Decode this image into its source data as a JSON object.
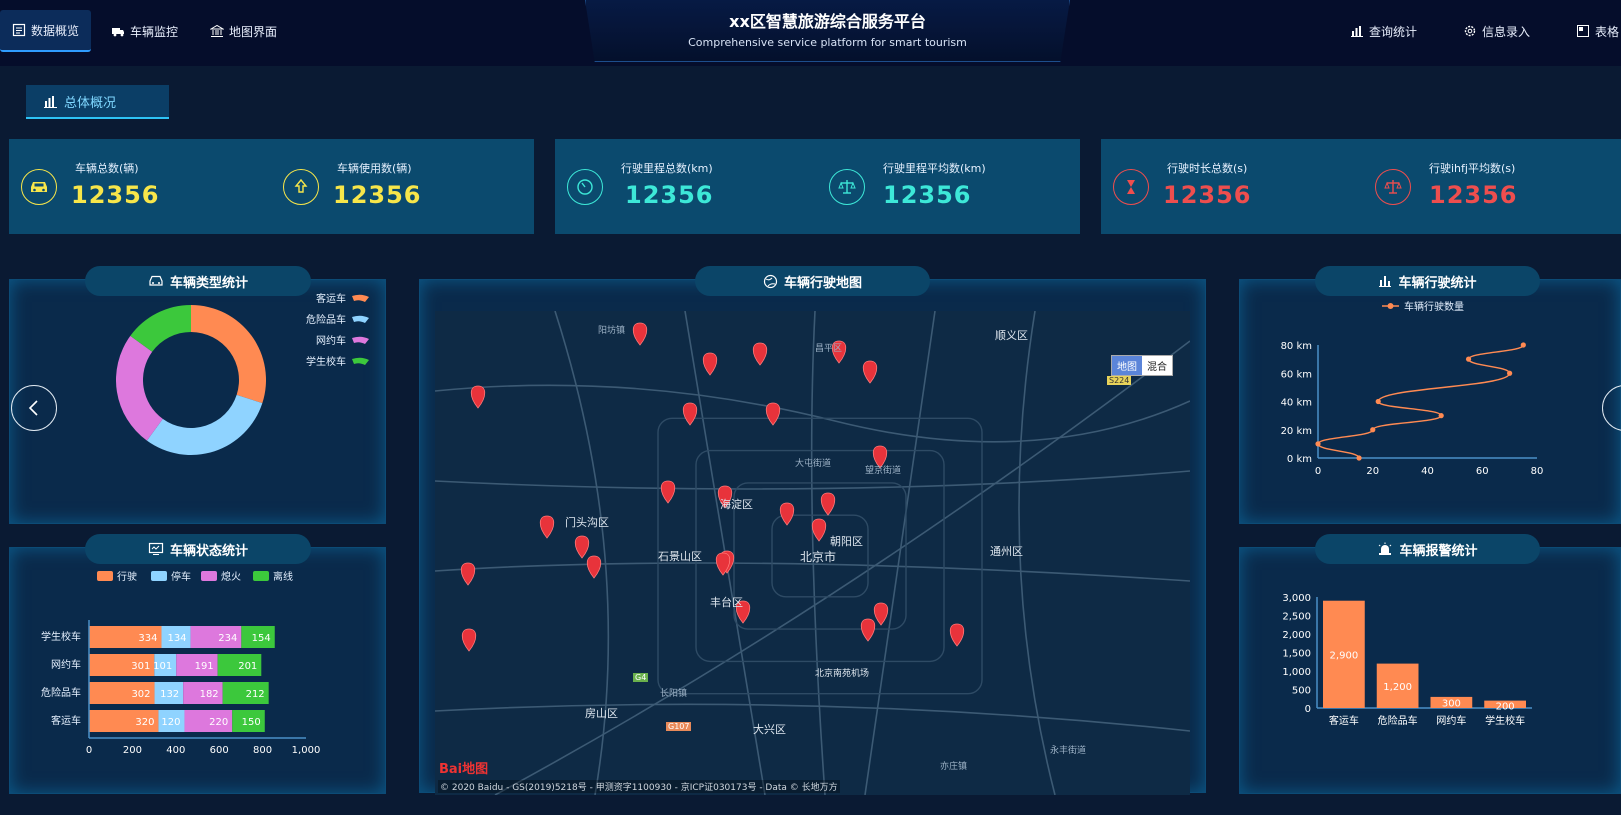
{
  "header": {
    "title": "xx区智慧旅游综合服务平台",
    "subtitle": "Comprehensive service platform for smart tourism",
    "nav_left": [
      {
        "label": "数据概览",
        "icon": "document-icon",
        "active": true
      },
      {
        "label": "车辆监控",
        "icon": "truck-icon",
        "active": false
      },
      {
        "label": "地图界面",
        "icon": "bank-icon",
        "active": false
      }
    ],
    "nav_right": [
      {
        "label": "查询统计",
        "icon": "bar-chart-icon"
      },
      {
        "label": "信息录入",
        "icon": "gear-icon"
      },
      {
        "label": "表格",
        "icon": "table-icon"
      }
    ]
  },
  "section": {
    "label": "总体概况"
  },
  "stats": [
    {
      "label": "车辆总数(辆)",
      "value": "12356",
      "color": "#f7e64a",
      "icon": "car-icon"
    },
    {
      "label": "车辆使用数(辆)",
      "value": "12356",
      "color": "#f7e64a",
      "icon": "upload-icon"
    },
    {
      "label": "行驶里程总数(km)",
      "value": "12356",
      "color": "#3de8d8",
      "icon": "timer-icon"
    },
    {
      "label": "行驶里程平均数(km)",
      "value": "12356",
      "color": "#3de8d8",
      "icon": "balance-icon"
    },
    {
      "label": "行驶时长总数(s)",
      "value": "12356",
      "color": "#ee4e4e",
      "icon": "hourglass-icon"
    },
    {
      "label": "行驶ihfj平均数(s)",
      "value": "12356",
      "color": "#ee4e4e",
      "icon": "balance-icon"
    }
  ],
  "panels": {
    "vehicle_type": {
      "title": "车辆类型统计"
    },
    "vehicle_status": {
      "title": "车辆状态统计"
    },
    "map": {
      "title": "车辆行驶地图"
    },
    "driving": {
      "title": "车辆行驶统计"
    },
    "alarm": {
      "title": "车辆报警统计"
    }
  },
  "colors": {
    "orange": "#ff8a52",
    "blue": "#8fd3ff",
    "purple": "#dd78dd",
    "green": "#3cc83c"
  },
  "map": {
    "toggle_map": "地图",
    "toggle_mixed": "混合",
    "logo": "Bai地图",
    "copyright": "© 2020 Baidu - GS(2019)5218号 - 甲测资字1100930 - 京ICP证030173号 - Data © 长地万方",
    "labels": [
      "顺义区",
      "昌平区",
      "门头沟区",
      "石景山区",
      "北京市",
      "朝阳区",
      "海淀区",
      "丰台区",
      "通州区",
      "大兴区",
      "房山区",
      "北京南苑机场",
      "大屯街道",
      "望京街道",
      "永丰街道",
      "阳坊镇",
      "长阳镇",
      "亦庄镇"
    ],
    "route_label_1": "S224",
    "route_label_2": "G4",
    "route_label_3": "G107"
  },
  "chart_data": [
    {
      "type": "pie",
      "title": "车辆类型统计",
      "categories": [
        "客运车",
        "危险品车",
        "网约车",
        "学生校车"
      ],
      "values": [
        30,
        30,
        25,
        15
      ],
      "legend": "top-right"
    },
    {
      "type": "bar",
      "orientation": "horizontal",
      "stacked": true,
      "title": "车辆状态统计",
      "categories": [
        "客运车",
        "危险品车",
        "网约车",
        "学生校车"
      ],
      "series": [
        {
          "name": "行驶",
          "values": [
            320,
            302,
            301,
            334
          ]
        },
        {
          "name": "停车",
          "values": [
            120,
            132,
            101,
            134
          ]
        },
        {
          "name": "熄火",
          "values": [
            220,
            182,
            191,
            234
          ]
        },
        {
          "name": "离线",
          "values": [
            150,
            212,
            201,
            154
          ]
        }
      ],
      "xlim": [
        0,
        1000
      ],
      "xticks": [
        "0",
        "200",
        "400",
        "600",
        "800",
        "1,000"
      ],
      "legend": "top"
    },
    {
      "type": "line",
      "title": "车辆行驶统计",
      "series": [
        {
          "name": "车辆行驶数量",
          "x": [
            15,
            0,
            20,
            45,
            22,
            70,
            55,
            75
          ],
          "y": [
            0,
            10,
            20,
            30,
            40,
            60,
            70,
            80
          ]
        }
      ],
      "xlim": [
        0,
        80
      ],
      "ylim": [
        0,
        80
      ],
      "xticks": [
        "0",
        "20",
        "40",
        "60",
        "80"
      ],
      "yticks": [
        "0 km",
        "20 km",
        "40 km",
        "60 km",
        "80 km"
      ],
      "legend": "top"
    },
    {
      "type": "bar",
      "title": "车辆报警统计",
      "categories": [
        "客运车",
        "危险品车",
        "网约车",
        "学生校车"
      ],
      "values": [
        2900,
        1200,
        300,
        200
      ],
      "value_labels": [
        "2,900",
        "1,200",
        "300",
        "200"
      ],
      "ylim": [
        0,
        3000
      ],
      "yticks": [
        "0",
        "500",
        "1,000",
        "1,500",
        "2,000",
        "2,500",
        "3,000"
      ]
    }
  ]
}
